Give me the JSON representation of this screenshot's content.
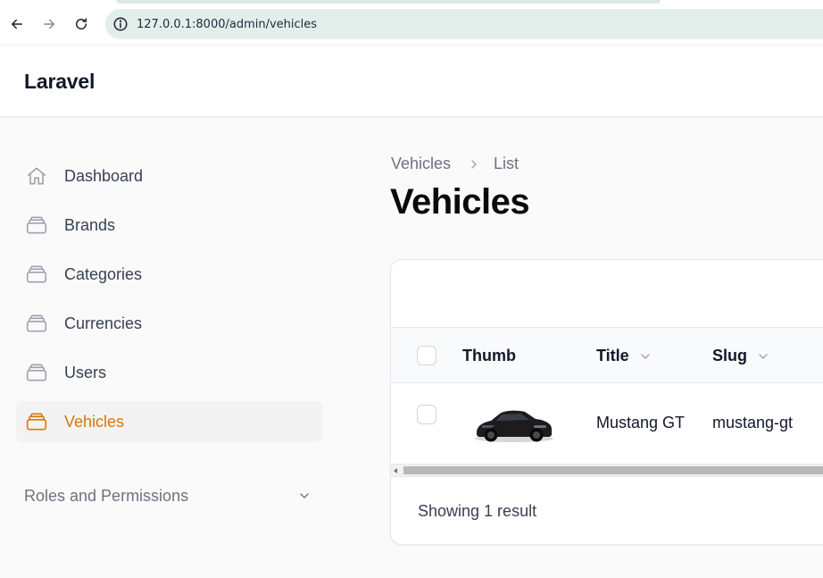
{
  "browser": {
    "url": "127.0.0.1:8000/admin/vehicles",
    "icons": [
      "back-arrow-icon",
      "forward-arrow-icon",
      "reload-icon",
      "info-icon"
    ]
  },
  "app": {
    "brand": "Laravel"
  },
  "sidebar": {
    "items": [
      {
        "label": "Dashboard",
        "icon": "home-icon",
        "active": false
      },
      {
        "label": "Brands",
        "icon": "rectangle-stack-icon",
        "active": false
      },
      {
        "label": "Categories",
        "icon": "rectangle-stack-icon",
        "active": false
      },
      {
        "label": "Currencies",
        "icon": "rectangle-stack-icon",
        "active": false
      },
      {
        "label": "Users",
        "icon": "rectangle-stack-icon",
        "active": false
      },
      {
        "label": "Vehicles",
        "icon": "rectangle-stack-icon",
        "active": true
      }
    ],
    "group_label": "Roles and Permissions"
  },
  "breadcrumb": {
    "items": [
      "Vehicles",
      "List"
    ]
  },
  "page": {
    "title": "Vehicles"
  },
  "table": {
    "columns": [
      {
        "label": "Thumb",
        "sortable": false
      },
      {
        "label": "Title",
        "sortable": true
      },
      {
        "label": "Slug",
        "sortable": true
      }
    ],
    "rows": [
      {
        "thumb": "car-thumbnail",
        "title": "Mustang GT",
        "slug": "mustang-gt"
      }
    ],
    "footer": "Showing 1 result"
  },
  "colors": {
    "accent": "#d97706",
    "text": "#111827",
    "muted": "#6b7280",
    "background": "#fafafa"
  }
}
